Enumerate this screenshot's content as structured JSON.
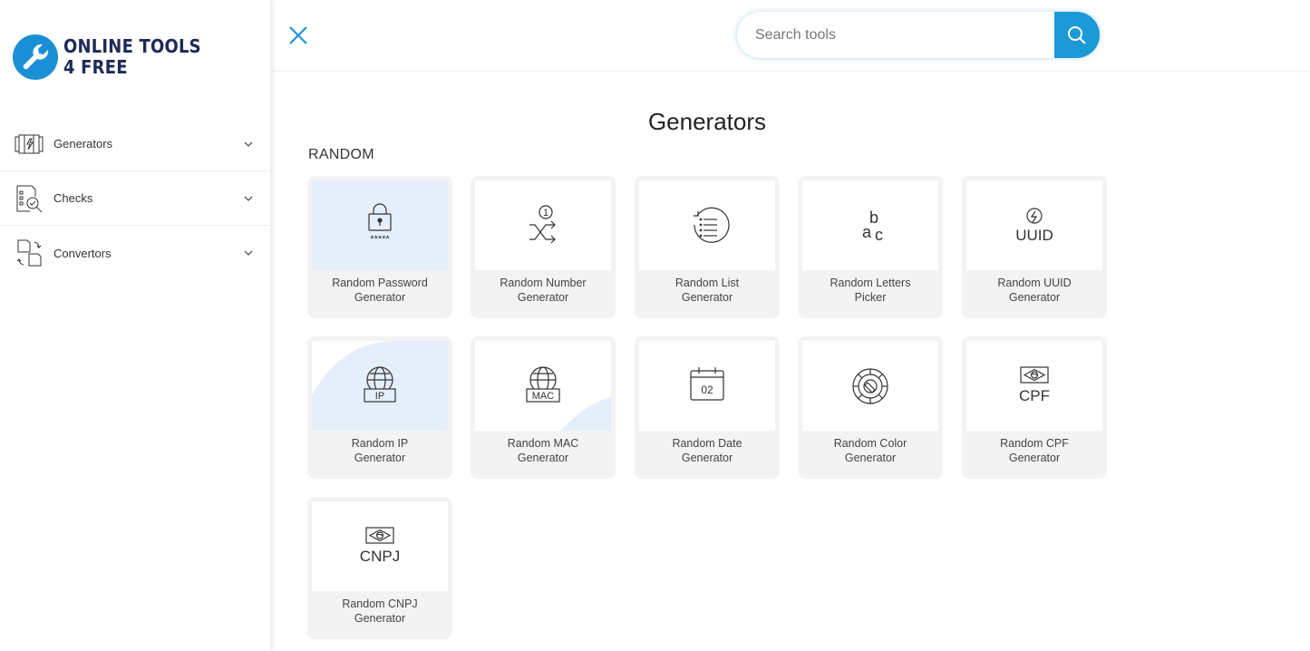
{
  "brand": {
    "line1": "ONLINE TOOLS",
    "line2": "4 FREE"
  },
  "nav": {
    "items": [
      {
        "label": "Generators",
        "icon": "generators-icon"
      },
      {
        "label": "Checks",
        "icon": "checks-icon"
      },
      {
        "label": "Convertors",
        "icon": "convertors-icon"
      }
    ]
  },
  "search": {
    "placeholder": "Search tools",
    "value": ""
  },
  "main": {
    "title": "Generators",
    "section": "RANDOM",
    "cards": [
      {
        "line1": "Random Password",
        "line2": "Generator",
        "icon": "password-lock-icon",
        "icon_text": "*****"
      },
      {
        "line1": "Random Number",
        "line2": "Generator",
        "icon": "shuffle-number-icon",
        "icon_text": "1"
      },
      {
        "line1": "Random List",
        "line2": "Generator",
        "icon": "list-refresh-icon"
      },
      {
        "line1": "Random Letters",
        "line2": "Picker",
        "icon": "letters-abc-icon",
        "icon_text": [
          "a",
          "b",
          "c"
        ]
      },
      {
        "line1": "Random UUID",
        "line2": "Generator",
        "icon": "uuid-icon",
        "icon_text": "UUID"
      },
      {
        "line1": "Random IP",
        "line2": "Generator",
        "icon": "globe-ip-icon",
        "icon_text": "IP"
      },
      {
        "line1": "Random MAC",
        "line2": "Generator",
        "icon": "globe-mac-icon",
        "icon_text": "MAC"
      },
      {
        "line1": "Random Date",
        "line2": "Generator",
        "icon": "calendar-icon",
        "icon_text": "02"
      },
      {
        "line1": "Random Color",
        "line2": "Generator",
        "icon": "color-wheel-icon"
      },
      {
        "line1": "Random CPF",
        "line2": "Generator",
        "icon": "brazil-flag-cpf-icon",
        "icon_text": "CPF"
      },
      {
        "line1": "Random CNPJ",
        "line2": "Generator",
        "icon": "brazil-flag-cnpj-icon",
        "icon_text": "CNPJ"
      }
    ]
  },
  "colors": {
    "accent": "#1b9ad6",
    "brand_text": "#1d2a57",
    "card_bg": "#f3f3f3",
    "highlight": "#e5effc"
  }
}
